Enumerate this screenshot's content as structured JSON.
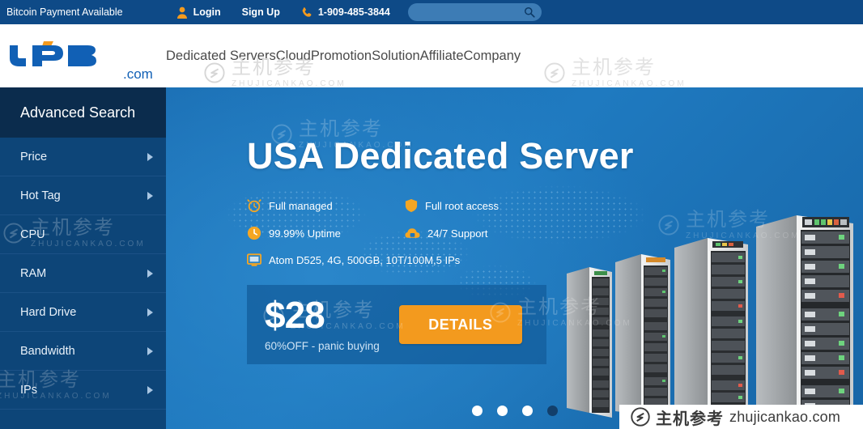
{
  "topbar": {
    "promo": "Bitcoin Payment Available",
    "login": "Login",
    "signup": "Sign Up",
    "phone": "1-909-485-3844",
    "search_value": "",
    "search_placeholder": "",
    "icons": {
      "user": "user-icon",
      "phone": "phone-icon",
      "search": "search-icon"
    },
    "bg_color": "#0e4a87",
    "accent_color": "#f39a1e"
  },
  "header": {
    "logo_text": "VPB",
    "logo_tld": ".com",
    "nav": [
      {
        "label": "Dedicated Servers"
      },
      {
        "label": "Cloud"
      },
      {
        "label": "Promotion"
      },
      {
        "label": "Solution"
      },
      {
        "label": "Affiliate"
      },
      {
        "label": "Company"
      }
    ]
  },
  "sidebar": {
    "title": "Advanced Search",
    "bg_color": "#0d4578",
    "title_bg_color": "#0b2c4d",
    "items": [
      {
        "label": "Price",
        "arrow": true
      },
      {
        "label": "Hot Tag",
        "arrow": true
      },
      {
        "label": "CPU",
        "arrow": false
      },
      {
        "label": "RAM",
        "arrow": true
      },
      {
        "label": "Hard Drive",
        "arrow": true
      },
      {
        "label": "Bandwidth",
        "arrow": true
      },
      {
        "label": "IPs",
        "arrow": true
      }
    ]
  },
  "hero": {
    "title": "USA Dedicated Server",
    "bg_color": "#1e76bd",
    "features": [
      {
        "label": "Full managed",
        "icon": "alarm-clock-icon"
      },
      {
        "label": "Full root access",
        "icon": "shield-icon"
      },
      {
        "label": "99.99% Uptime",
        "icon": "clock-icon"
      },
      {
        "label": "24/7 Support",
        "icon": "support-cloud-icon"
      },
      {
        "label": "Atom D525, 4G, 500GB, 10T/100M,5 IPs",
        "icon": "monitor-icon"
      }
    ],
    "price": {
      "amount": "$28",
      "subtitle": "60%OFF - panic buying",
      "cta": "DETAILS",
      "cta_color": "#f39a1e"
    },
    "carousel": {
      "total": 4,
      "active_index": 3
    },
    "illustration": "server-rack-image"
  },
  "watermarks": {
    "cn": "主机参考",
    "en": "ZHUJICANKAO.COM",
    "bar_cn": "主机参考",
    "bar_en": "zhujicankao.com"
  }
}
